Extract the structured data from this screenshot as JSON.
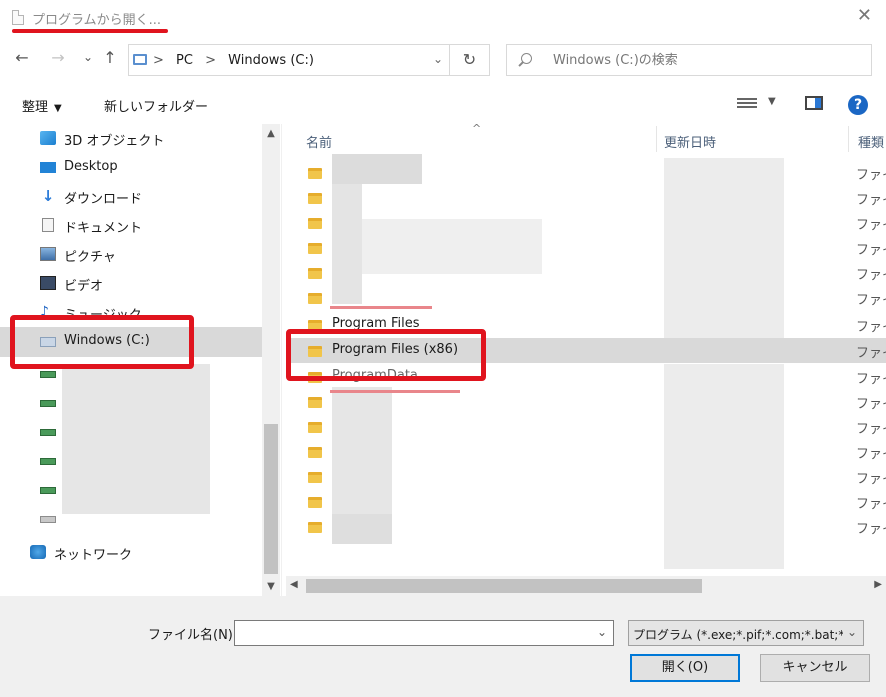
{
  "window": {
    "title": "プログラムから開く...",
    "close_glyph": "✕"
  },
  "nav": {
    "back_glyph": "←",
    "forward_glyph": "→",
    "recent_glyph": "⌄",
    "up_glyph": "↑",
    "refresh_glyph": "↻",
    "dropdown_glyph": "⌄",
    "breadcrumb": [
      "PC",
      "Windows (C:)"
    ],
    "breadcrumb_sep": ">",
    "search_placeholder": "Windows (C:)の検索"
  },
  "commandbar": {
    "organize_label": "整理",
    "new_folder_label": "新しいフォルダー",
    "help_glyph": "?"
  },
  "sidebar": {
    "items": [
      {
        "label": "3D オブジェクト",
        "icon": "cube-icon"
      },
      {
        "label": "Desktop",
        "icon": "desktop-icon"
      },
      {
        "label": "ダウンロード",
        "icon": "download-icon"
      },
      {
        "label": "ドキュメント",
        "icon": "document-icon"
      },
      {
        "label": "ピクチャ",
        "icon": "pictures-icon"
      },
      {
        "label": "ビデオ",
        "icon": "video-icon"
      },
      {
        "label": "ミュージック",
        "icon": "music-icon"
      },
      {
        "label": "Windows (C:)",
        "icon": "drive-icon",
        "selected": true
      },
      {
        "label": "ネットワーク",
        "icon": "network-icon"
      }
    ]
  },
  "filelist": {
    "columns": [
      "名前",
      "更新日時",
      "種類"
    ],
    "type_text": "ファイ",
    "rows": [
      {
        "name": ""
      },
      {
        "name": ""
      },
      {
        "name": ""
      },
      {
        "name": ""
      },
      {
        "name": ""
      },
      {
        "name": ""
      },
      {
        "name": "Program Files"
      },
      {
        "name": "Program Files (x86)",
        "selected": true
      },
      {
        "name": "ProgramData"
      },
      {
        "name": ""
      },
      {
        "name": ""
      },
      {
        "name": ""
      },
      {
        "name": ""
      },
      {
        "name": ""
      },
      {
        "name": ""
      },
      {
        "name": ""
      }
    ]
  },
  "footer": {
    "filename_label": "ファイル名(N):",
    "filename_value": "",
    "filter_value": "プログラム (*.exe;*.pif;*.com;*.bat;*",
    "open_label": "開く(O)",
    "cancel_label": "キャンセル"
  },
  "colors": {
    "highlight": "#e0141e",
    "selection": "#d9d9d9",
    "accent": "#0078d7"
  }
}
